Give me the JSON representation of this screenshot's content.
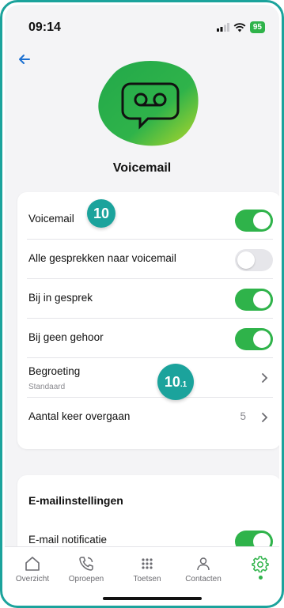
{
  "status": {
    "time": "09:14",
    "battery": "95"
  },
  "page": {
    "title": "Voicemail"
  },
  "settings": [
    {
      "label": "Voicemail",
      "toggle": true
    },
    {
      "label": "Alle gesprekken naar voicemail",
      "toggle": false
    },
    {
      "label": "Bij in gesprek",
      "toggle": true
    },
    {
      "label": "Bij geen gehoor",
      "toggle": true
    },
    {
      "label": "Begroeting",
      "sub": "Standaard"
    },
    {
      "label": "Aantal keer overgaan",
      "value": "5"
    }
  ],
  "badges": {
    "first": "10",
    "second_main": "10",
    "second_sub": ".1"
  },
  "email": {
    "title": "E-mailinstellingen",
    "row": {
      "label": "E-mail notificatie",
      "toggle": true
    }
  },
  "tabs": [
    {
      "label": "Overzicht",
      "icon": "home-icon"
    },
    {
      "label": "Oproepen",
      "icon": "phone-icon"
    },
    {
      "label": "Toetsen",
      "icon": "keypad-icon"
    },
    {
      "label": "Contacten",
      "icon": "person-icon"
    },
    {
      "label": "",
      "icon": "gear-icon",
      "active": true
    }
  ],
  "colors": {
    "accent": "#2fb34a",
    "teal": "#1ba39c",
    "back": "#1a6fd1"
  }
}
